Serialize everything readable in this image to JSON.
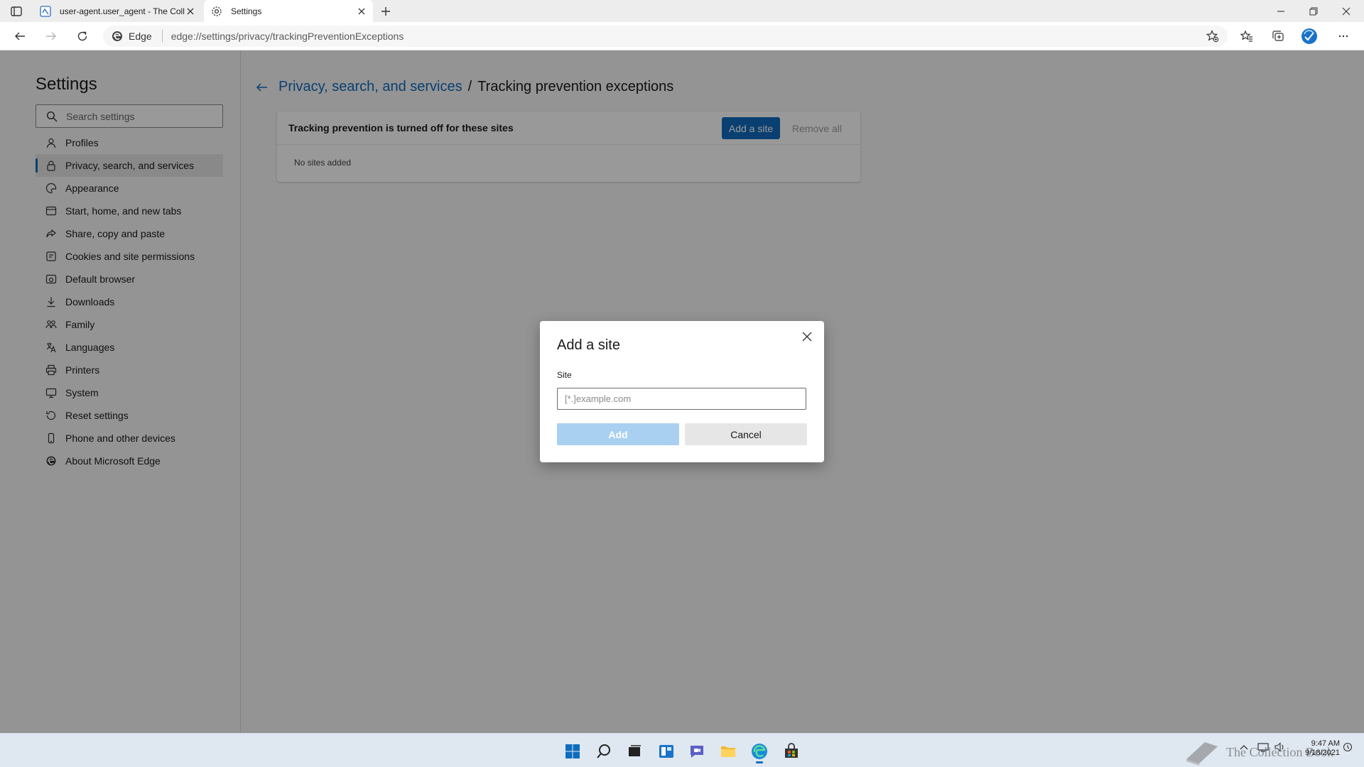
{
  "browser": {
    "tabs": [
      {
        "title": "user-agent.user_agent - The Coll",
        "icon": "document-favicon"
      },
      {
        "title": "Settings",
        "icon": "gear-icon"
      }
    ],
    "address": {
      "scheme_label": "Edge",
      "url": "edge://settings/privacy/trackingPreventionExceptions"
    }
  },
  "sidebar": {
    "title": "Settings",
    "search_placeholder": "Search settings",
    "items": [
      {
        "label": "Profiles",
        "icon": "profile-icon"
      },
      {
        "label": "Privacy, search, and services",
        "icon": "lock-icon",
        "active": true
      },
      {
        "label": "Appearance",
        "icon": "appearance-icon"
      },
      {
        "label": "Start, home, and new tabs",
        "icon": "home-tabs-icon"
      },
      {
        "label": "Share, copy and paste",
        "icon": "share-icon"
      },
      {
        "label": "Cookies and site permissions",
        "icon": "cookies-icon"
      },
      {
        "label": "Default browser",
        "icon": "browser-icon"
      },
      {
        "label": "Downloads",
        "icon": "download-icon"
      },
      {
        "label": "Family",
        "icon": "family-icon"
      },
      {
        "label": "Languages",
        "icon": "languages-icon"
      },
      {
        "label": "Printers",
        "icon": "printer-icon"
      },
      {
        "label": "System",
        "icon": "system-icon"
      },
      {
        "label": "Reset settings",
        "icon": "reset-icon"
      },
      {
        "label": "Phone and other devices",
        "icon": "phone-icon"
      },
      {
        "label": "About Microsoft Edge",
        "icon": "edge-icon"
      }
    ]
  },
  "main": {
    "breadcrumb_parent": "Privacy, search, and services",
    "breadcrumb_sep": "/",
    "breadcrumb_current": "Tracking prevention exceptions",
    "card_title": "Tracking prevention is turned off for these sites",
    "add_site_label": "Add a site",
    "remove_all_label": "Remove all",
    "empty_text": "No sites added"
  },
  "dialog": {
    "title": "Add a site",
    "field_label": "Site",
    "placeholder": "[*.]example.com",
    "add_label": "Add",
    "cancel_label": "Cancel"
  },
  "taskbar": {
    "time": "9:47 AM",
    "date": "9/18/2021",
    "watermark": "The Collection Book"
  },
  "colors": {
    "accent": "#0f6cbd",
    "accent_disabled": "#a9d0f0",
    "overlay": "rgba(0,0,0,0.40)"
  }
}
